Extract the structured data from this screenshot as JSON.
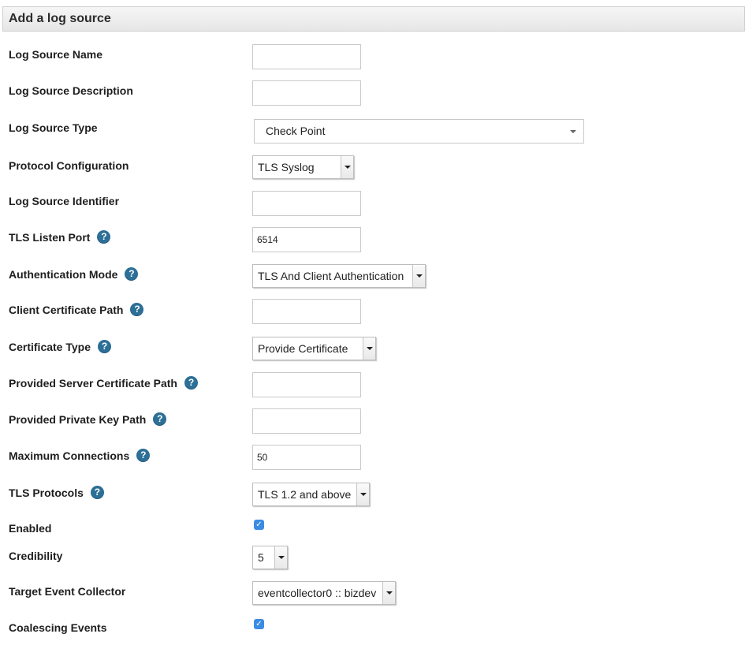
{
  "form": {
    "title": "Add a log source",
    "help_glyph": "?",
    "fields": {
      "log_source_name": {
        "label": "Log Source Name",
        "value": ""
      },
      "log_source_description": {
        "label": "Log Source Description",
        "value": ""
      },
      "log_source_type": {
        "label": "Log Source Type",
        "value": "Check Point"
      },
      "protocol_configuration": {
        "label": "Protocol Configuration",
        "value": "TLS Syslog"
      },
      "log_source_identifier": {
        "label": "Log Source Identifier",
        "value": ""
      },
      "tls_listen_port": {
        "label": "TLS Listen Port",
        "value": "6514"
      },
      "authentication_mode": {
        "label": "Authentication Mode",
        "value": "TLS And Client Authentication"
      },
      "client_certificate_path": {
        "label": "Client Certificate Path",
        "value": ""
      },
      "certificate_type": {
        "label": "Certificate Type",
        "value": "Provide Certificate"
      },
      "provided_server_certificate_path": {
        "label": "Provided Server Certificate Path",
        "value": ""
      },
      "provided_private_key_path": {
        "label": "Provided Private Key Path",
        "value": ""
      },
      "maximum_connections": {
        "label": "Maximum Connections",
        "value": "50"
      },
      "tls_protocols": {
        "label": "TLS Protocols",
        "value": "TLS 1.2 and above"
      },
      "enabled": {
        "label": "Enabled",
        "checked": true
      },
      "credibility": {
        "label": "Credibility",
        "value": "5"
      },
      "target_event_collector": {
        "label": "Target Event Collector",
        "value": "eventcollector0 :: bizdev"
      },
      "coalescing_events": {
        "label": "Coalescing Events",
        "checked": true
      }
    }
  },
  "colors": {
    "help_icon": "#2c6f97",
    "checkbox": "#3b8ce3",
    "header_bg": "#ececec"
  }
}
